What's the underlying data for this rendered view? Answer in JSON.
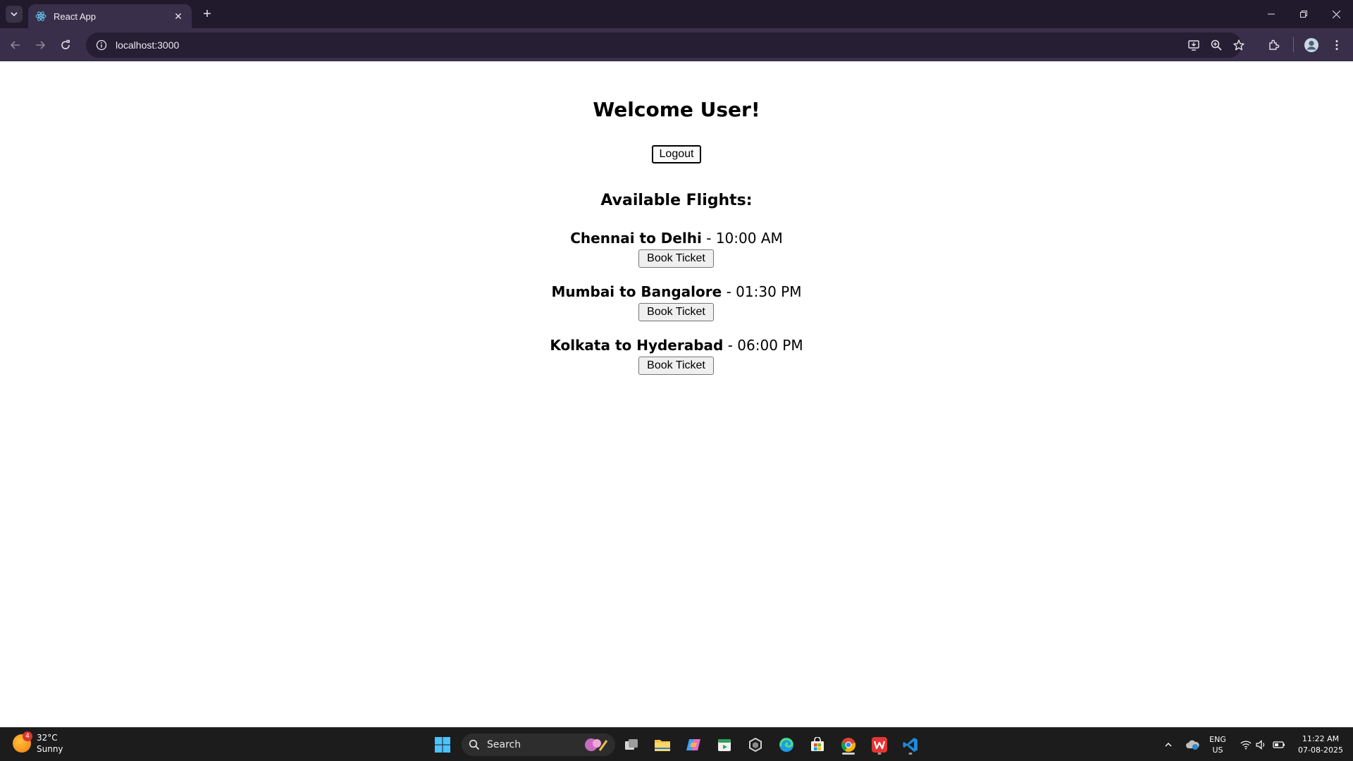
{
  "browser": {
    "tab_title": "React App",
    "url": "localhost:3000"
  },
  "page": {
    "welcome": "Welcome User!",
    "logout_label": "Logout",
    "flights_heading": "Available Flights:",
    "book_label": "Book Ticket",
    "flights": [
      {
        "route": "Chennai to Delhi",
        "time": "10:00 AM"
      },
      {
        "route": "Mumbai to Bangalore",
        "time": "01:30 PM"
      },
      {
        "route": "Kolkata to Hyderabad",
        "time": "06:00 PM"
      }
    ]
  },
  "taskbar": {
    "weather_temp": "32°C",
    "weather_desc": "Sunny",
    "weather_badge": "4",
    "search_label": "Search",
    "lang": "ENG",
    "region": "US",
    "time": "11:22 AM",
    "date": "07-08-2025"
  },
  "colors": {
    "tabbar_bg": "#201a2c",
    "toolbar_bg": "#3a2f4b",
    "taskbar_bg": "#1c1c1c"
  }
}
